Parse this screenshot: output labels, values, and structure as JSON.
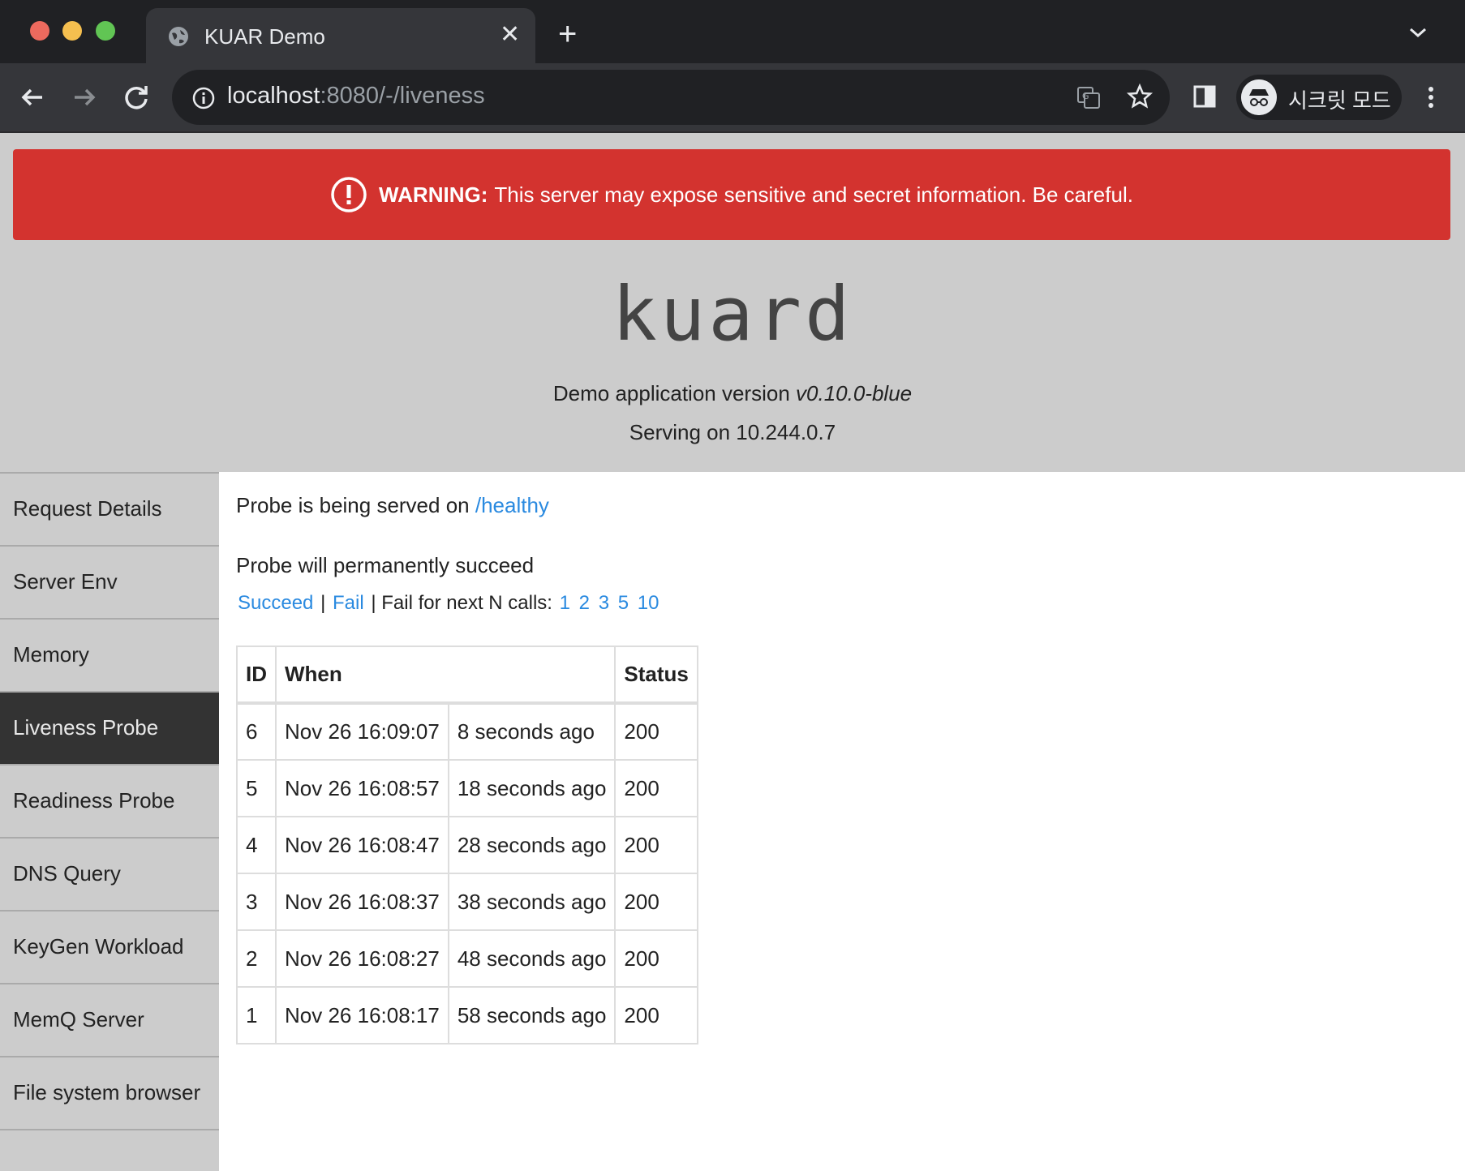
{
  "browser": {
    "tab_title": "KUAR Demo",
    "url_host": "localhost",
    "url_path": ":8080/-/liveness",
    "incognito_label": "시크릿 모드"
  },
  "warning": {
    "strong": "WARNING:",
    "text": "This server may expose sensitive and secret information. Be careful."
  },
  "header": {
    "brand": "kuard",
    "version_prefix": "Demo application version",
    "version": "v0.10.0-blue",
    "serving": "Serving on 10.244.0.7"
  },
  "sidebar": {
    "items": [
      {
        "label": "Request Details",
        "active": false
      },
      {
        "label": "Server Env",
        "active": false
      },
      {
        "label": "Memory",
        "active": false
      },
      {
        "label": "Liveness Probe",
        "active": true
      },
      {
        "label": "Readiness Probe",
        "active": false
      },
      {
        "label": "DNS Query",
        "active": false
      },
      {
        "label": "KeyGen Workload",
        "active": false
      },
      {
        "label": "MemQ Server",
        "active": false
      },
      {
        "label": "File system browser",
        "active": false
      }
    ]
  },
  "probe": {
    "served_prefix": "Probe is being served on",
    "served_path": "/healthy",
    "status_text": "Probe will permanently succeed",
    "succeed_label": "Succeed",
    "separator": "|",
    "fail_label": "Fail",
    "fail_n_label": "Fail for next N calls:",
    "fail_n_options": [
      "1",
      "2",
      "3",
      "5",
      "10"
    ]
  },
  "table": {
    "headers": {
      "id": "ID",
      "when": "When",
      "status": "Status"
    },
    "rows": [
      {
        "id": "6",
        "time": "Nov 26 16:09:07",
        "ago": "8 seconds ago",
        "status": "200"
      },
      {
        "id": "5",
        "time": "Nov 26 16:08:57",
        "ago": "18 seconds ago",
        "status": "200"
      },
      {
        "id": "4",
        "time": "Nov 26 16:08:47",
        "ago": "28 seconds ago",
        "status": "200"
      },
      {
        "id": "3",
        "time": "Nov 26 16:08:37",
        "ago": "38 seconds ago",
        "status": "200"
      },
      {
        "id": "2",
        "time": "Nov 26 16:08:27",
        "ago": "48 seconds ago",
        "status": "200"
      },
      {
        "id": "1",
        "time": "Nov 26 16:08:17",
        "ago": "58 seconds ago",
        "status": "200"
      }
    ]
  },
  "colors": {
    "warning_bg": "#d3332f",
    "link": "#2a8ae0",
    "active_nav_bg": "#333333",
    "page_bg": "#cccccc"
  }
}
